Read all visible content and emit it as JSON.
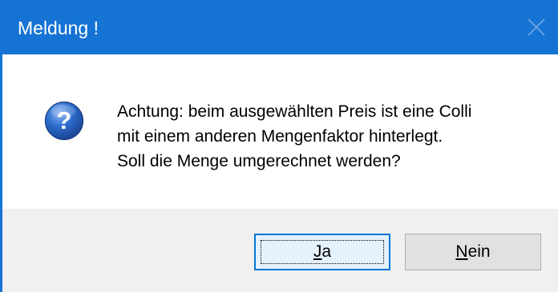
{
  "window": {
    "title": "Meldung !",
    "close_icon": "close-icon"
  },
  "message": {
    "icon": "question-icon",
    "lines": [
      "Achtung: beim ausgewählten Preis ist eine Colli",
      "mit einem anderen Mengenfaktor hinterlegt.",
      "Soll die Menge umgerechnet werden?"
    ]
  },
  "buttons": {
    "yes": {
      "first": "J",
      "rest": "a"
    },
    "no": {
      "first": "N",
      "rest": "ein"
    }
  },
  "colors": {
    "titlebar": "#1573d3",
    "button_bar": "#f0f0f0",
    "default_button_border": "#0078d7"
  }
}
